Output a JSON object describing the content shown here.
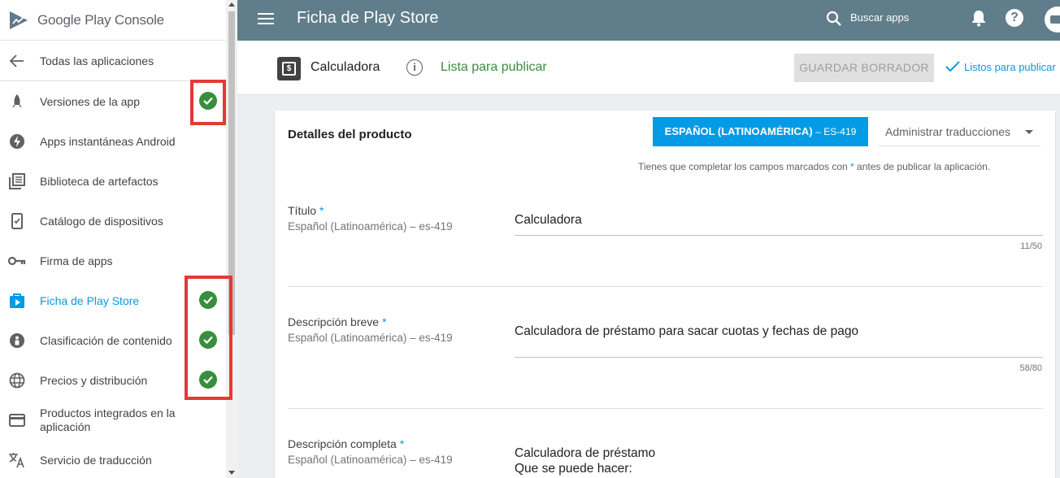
{
  "brand": {
    "logo_text": "Google Play Console"
  },
  "sidebar": {
    "back_label": "Todas las aplicaciones",
    "items": [
      {
        "label": "Versiones de la app",
        "icon": "rocket-icon",
        "checked": true
      },
      {
        "label": "Apps instantáneas Android",
        "icon": "bolt-icon",
        "checked": false
      },
      {
        "label": "Biblioteca de artefactos",
        "icon": "library-icon",
        "checked": false
      },
      {
        "label": "Catálogo de dispositivos",
        "icon": "device-icon",
        "checked": false
      },
      {
        "label": "Firma de apps",
        "icon": "key-icon",
        "checked": false
      },
      {
        "label": "Ficha de Play Store",
        "icon": "store-listing-icon",
        "checked": true,
        "active": true
      },
      {
        "label": "Clasificación de contenido",
        "icon": "content-rating-icon",
        "checked": true
      },
      {
        "label": "Precios y distribución",
        "icon": "globe-icon",
        "checked": true
      },
      {
        "label": "Productos integrados en la aplicación",
        "icon": "credit-card-icon",
        "checked": false
      },
      {
        "label": "Servicio de traducción",
        "icon": "translate-icon",
        "checked": false
      }
    ]
  },
  "topbar": {
    "title": "Ficha de Play Store",
    "search_label": "Buscar apps"
  },
  "subheader": {
    "app_name": "Calculadora",
    "status": "Lista para publicar",
    "draft_button": "GUARDAR BORRADOR",
    "ready_link": "Listos para publicar"
  },
  "card": {
    "title": "Detalles del producto",
    "language_button": "ESPAÑOL (LATINOAMÉRICA)",
    "language_code": "– ES-419",
    "manage_translations": "Administrar traducciones",
    "required_note_pre": "Tienes que completar los campos marcados con",
    "required_note_star": "*",
    "required_note_post": "antes de publicar la aplicación.",
    "fields": [
      {
        "label": "Título",
        "star": "*",
        "sub": "Español (Latinoamérica) – es-419",
        "value": "Calculadora",
        "counter": "11/50"
      },
      {
        "label": "Descripción breve",
        "star": "*",
        "sub": "Español (Latinoamérica) – es-419",
        "value": "Calculadora de préstamo para sacar cuotas y fechas de pago",
        "counter": "58/80"
      },
      {
        "label": "Descripción completa",
        "star": "*",
        "sub": "Español (Latinoamérica) – es-419",
        "value_line1": "Calculadora de préstamo",
        "value_line2": "Que se puede hacer:"
      }
    ]
  },
  "colors": {
    "topbar": "#607d8b",
    "accent": "#039be5",
    "success": "#388e3c",
    "highlight": "#e53935"
  }
}
